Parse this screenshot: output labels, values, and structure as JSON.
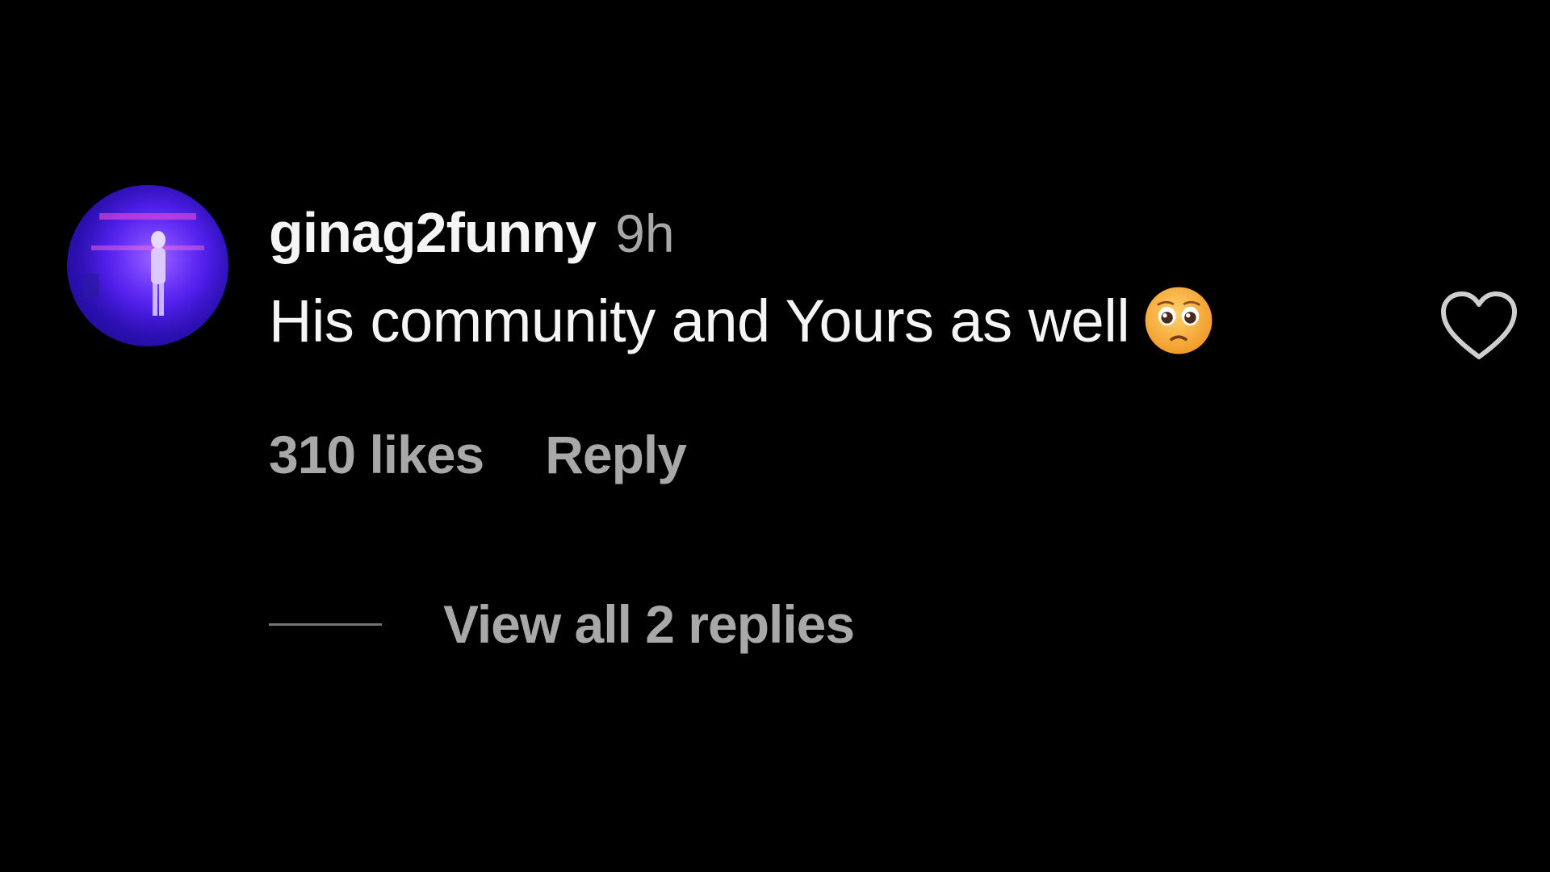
{
  "comment": {
    "username": "ginag2funny",
    "timestamp": "9h",
    "text": "His community and Yours as well",
    "emoji": "pleading-face-emoji",
    "likes_text": "310 likes",
    "reply_label": "Reply",
    "view_replies_label": "View all 2 replies"
  },
  "colors": {
    "background": "#000000",
    "primary_text": "#f5f5f5",
    "secondary_text": "#a8a8a8",
    "avatar_tint": "#4b1be0",
    "emoji_fill": "#f7a331"
  },
  "icons": {
    "like": "heart-outline-icon",
    "emoji": "pleading-face-emoji"
  }
}
